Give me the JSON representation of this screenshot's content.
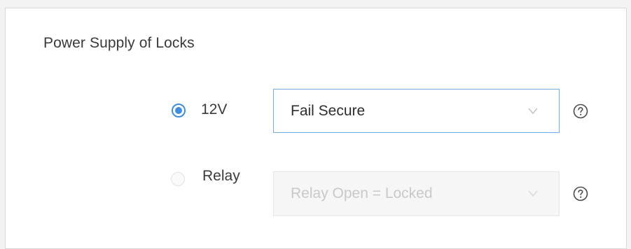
{
  "section": {
    "title": "Power Supply of Locks"
  },
  "options": [
    {
      "label": "12V",
      "selected": true,
      "select_value": "Fail Secure",
      "select_enabled": true
    },
    {
      "label": "Relay",
      "selected": false,
      "select_value": "Relay Open = Locked",
      "select_enabled": false
    }
  ],
  "icons": {
    "radio": "radio-button",
    "dropdown": "chevron-down-icon",
    "help": "question-circle-icon"
  },
  "colors": {
    "accent": "#3d8ee0",
    "text": "#3a3a3a",
    "disabled_text": "#c9c9c9"
  }
}
